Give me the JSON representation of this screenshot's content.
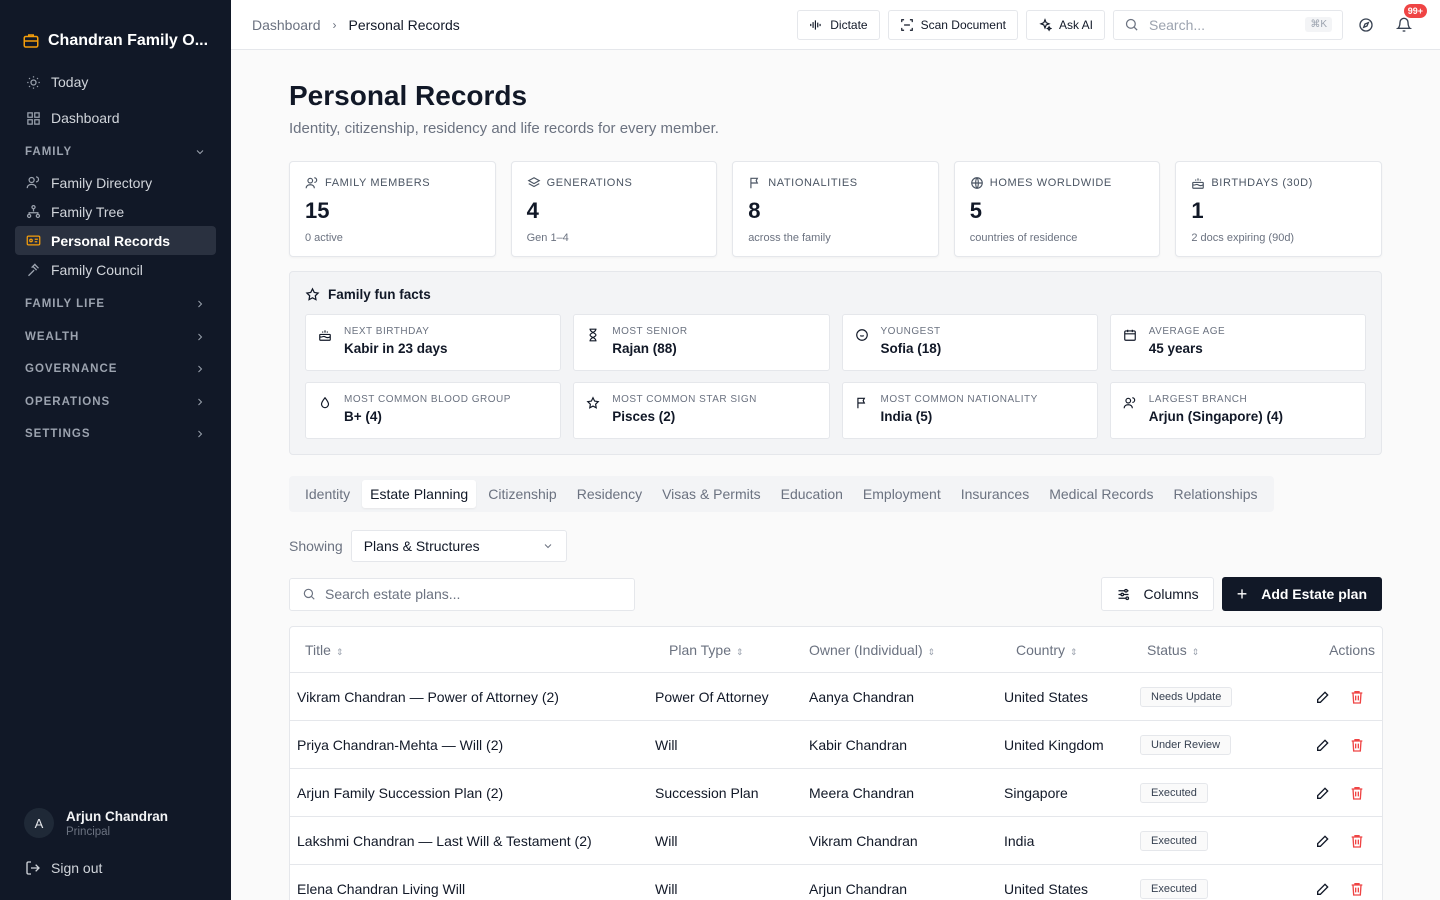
{
  "sidebar": {
    "brand": "Chandran Family O...",
    "top_items": [
      {
        "label": "Today",
        "icon": "sun-icon"
      },
      {
        "label": "Dashboard",
        "icon": "grid-icon"
      }
    ],
    "family_section": "FAMILY",
    "family_items": [
      {
        "label": "Family Directory",
        "icon": "users-icon"
      },
      {
        "label": "Family Tree",
        "icon": "tree-icon"
      },
      {
        "label": "Personal Records",
        "icon": "id-card-icon"
      },
      {
        "label": "Family Council",
        "icon": "gavel-icon"
      }
    ],
    "sections": [
      "FAMILY LIFE",
      "WEALTH",
      "GOVERNANCE",
      "OPERATIONS",
      "SETTINGS"
    ],
    "user": {
      "initial": "A",
      "name": "Arjun Chandran",
      "role": "Principal"
    },
    "signout": "Sign out"
  },
  "topbar": {
    "breadcrumb": [
      "Dashboard",
      "Personal Records"
    ],
    "buttons": {
      "dictate": "Dictate",
      "scan": "Scan Document",
      "ask": "Ask AI"
    },
    "search_placeholder": "Search...",
    "search_kbd": "⌘K",
    "notif_badge": "99+"
  },
  "page": {
    "title": "Personal Records",
    "subtitle": "Identity, citizenship, residency and life records for every member."
  },
  "stats": [
    {
      "label": "FAMILY MEMBERS",
      "value": "15",
      "sub": "0 active"
    },
    {
      "label": "GENERATIONS",
      "value": "4",
      "sub": "Gen 1–4"
    },
    {
      "label": "NATIONALITIES",
      "value": "8",
      "sub": "across the family"
    },
    {
      "label": "HOMES WORLDWIDE",
      "value": "5",
      "sub": "countries of residence"
    },
    {
      "label": "BIRTHDAYS (30D)",
      "value": "1",
      "sub": "2 docs expiring (90d)"
    }
  ],
  "facts": {
    "title": "Family fun facts",
    "items": [
      {
        "label": "NEXT BIRTHDAY",
        "value": "Kabir in 23 days"
      },
      {
        "label": "MOST SENIOR",
        "value": "Rajan (88)"
      },
      {
        "label": "YOUNGEST",
        "value": "Sofia (18)"
      },
      {
        "label": "AVERAGE AGE",
        "value": "45 years"
      },
      {
        "label": "MOST COMMON BLOOD GROUP",
        "value": "B+ (4)"
      },
      {
        "label": "MOST COMMON STAR SIGN",
        "value": "Pisces (2)"
      },
      {
        "label": "MOST COMMON NATIONALITY",
        "value": "India (5)"
      },
      {
        "label": "LARGEST BRANCH",
        "value": "Arjun (Singapore) (4)"
      }
    ]
  },
  "tabs": [
    "Identity",
    "Estate Planning",
    "Citizenship",
    "Residency",
    "Visas & Permits",
    "Education",
    "Employment",
    "Insurances",
    "Medical Records",
    "Relationships"
  ],
  "active_tab": "Estate Planning",
  "filter": {
    "label": "Showing",
    "value": "Plans & Structures"
  },
  "table_toolbar": {
    "search_placeholder": "Search estate plans...",
    "columns": "Columns",
    "add": "Add Estate plan"
  },
  "table": {
    "headers": {
      "title": "Title",
      "type": "Plan Type",
      "owner": "Owner (Individual)",
      "country": "Country",
      "status": "Status",
      "actions": "Actions"
    },
    "rows": [
      {
        "title": "Vikram Chandran — Power of Attorney (2)",
        "type": "Power Of Attorney",
        "owner": "Aanya Chandran",
        "country": "United States",
        "status": "Needs Update"
      },
      {
        "title": "Priya Chandran-Mehta — Will (2)",
        "type": "Will",
        "owner": "Kabir Chandran",
        "country": "United Kingdom",
        "status": "Under Review"
      },
      {
        "title": "Arjun Family Succession Plan (2)",
        "type": "Succession Plan",
        "owner": "Meera Chandran",
        "country": "Singapore",
        "status": "Executed"
      },
      {
        "title": "Lakshmi Chandran — Last Will & Testament (2)",
        "type": "Will",
        "owner": "Vikram Chandran",
        "country": "India",
        "status": "Executed"
      },
      {
        "title": "Elena Chandran Living Will",
        "type": "Will",
        "owner": "Arjun Chandran",
        "country": "United States",
        "status": "Executed"
      }
    ]
  },
  "colors": {
    "sidebar_bg": "#111827",
    "accent": "#f59e0b",
    "danger": "#ef4444"
  }
}
